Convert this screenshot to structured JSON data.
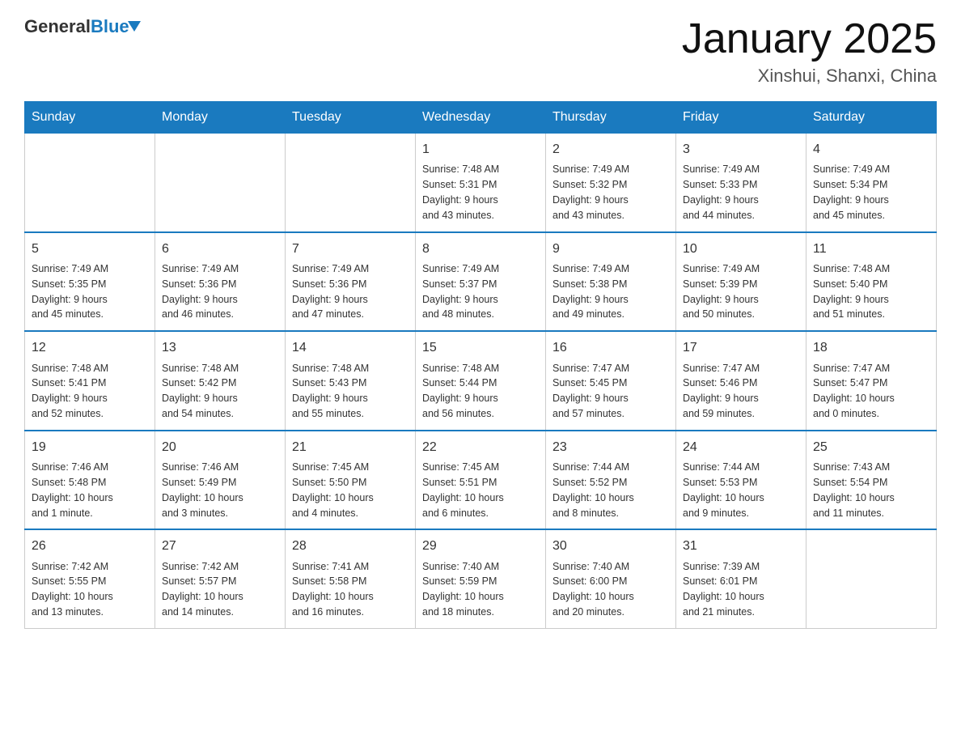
{
  "header": {
    "logo_general": "General",
    "logo_blue": "Blue",
    "title": "January 2025",
    "subtitle": "Xinshui, Shanxi, China"
  },
  "days_of_week": [
    "Sunday",
    "Monday",
    "Tuesday",
    "Wednesday",
    "Thursday",
    "Friday",
    "Saturday"
  ],
  "weeks": [
    [
      {
        "day": "",
        "info": ""
      },
      {
        "day": "",
        "info": ""
      },
      {
        "day": "",
        "info": ""
      },
      {
        "day": "1",
        "info": "Sunrise: 7:48 AM\nSunset: 5:31 PM\nDaylight: 9 hours\nand 43 minutes."
      },
      {
        "day": "2",
        "info": "Sunrise: 7:49 AM\nSunset: 5:32 PM\nDaylight: 9 hours\nand 43 minutes."
      },
      {
        "day": "3",
        "info": "Sunrise: 7:49 AM\nSunset: 5:33 PM\nDaylight: 9 hours\nand 44 minutes."
      },
      {
        "day": "4",
        "info": "Sunrise: 7:49 AM\nSunset: 5:34 PM\nDaylight: 9 hours\nand 45 minutes."
      }
    ],
    [
      {
        "day": "5",
        "info": "Sunrise: 7:49 AM\nSunset: 5:35 PM\nDaylight: 9 hours\nand 45 minutes."
      },
      {
        "day": "6",
        "info": "Sunrise: 7:49 AM\nSunset: 5:36 PM\nDaylight: 9 hours\nand 46 minutes."
      },
      {
        "day": "7",
        "info": "Sunrise: 7:49 AM\nSunset: 5:36 PM\nDaylight: 9 hours\nand 47 minutes."
      },
      {
        "day": "8",
        "info": "Sunrise: 7:49 AM\nSunset: 5:37 PM\nDaylight: 9 hours\nand 48 minutes."
      },
      {
        "day": "9",
        "info": "Sunrise: 7:49 AM\nSunset: 5:38 PM\nDaylight: 9 hours\nand 49 minutes."
      },
      {
        "day": "10",
        "info": "Sunrise: 7:49 AM\nSunset: 5:39 PM\nDaylight: 9 hours\nand 50 minutes."
      },
      {
        "day": "11",
        "info": "Sunrise: 7:48 AM\nSunset: 5:40 PM\nDaylight: 9 hours\nand 51 minutes."
      }
    ],
    [
      {
        "day": "12",
        "info": "Sunrise: 7:48 AM\nSunset: 5:41 PM\nDaylight: 9 hours\nand 52 minutes."
      },
      {
        "day": "13",
        "info": "Sunrise: 7:48 AM\nSunset: 5:42 PM\nDaylight: 9 hours\nand 54 minutes."
      },
      {
        "day": "14",
        "info": "Sunrise: 7:48 AM\nSunset: 5:43 PM\nDaylight: 9 hours\nand 55 minutes."
      },
      {
        "day": "15",
        "info": "Sunrise: 7:48 AM\nSunset: 5:44 PM\nDaylight: 9 hours\nand 56 minutes."
      },
      {
        "day": "16",
        "info": "Sunrise: 7:47 AM\nSunset: 5:45 PM\nDaylight: 9 hours\nand 57 minutes."
      },
      {
        "day": "17",
        "info": "Sunrise: 7:47 AM\nSunset: 5:46 PM\nDaylight: 9 hours\nand 59 minutes."
      },
      {
        "day": "18",
        "info": "Sunrise: 7:47 AM\nSunset: 5:47 PM\nDaylight: 10 hours\nand 0 minutes."
      }
    ],
    [
      {
        "day": "19",
        "info": "Sunrise: 7:46 AM\nSunset: 5:48 PM\nDaylight: 10 hours\nand 1 minute."
      },
      {
        "day": "20",
        "info": "Sunrise: 7:46 AM\nSunset: 5:49 PM\nDaylight: 10 hours\nand 3 minutes."
      },
      {
        "day": "21",
        "info": "Sunrise: 7:45 AM\nSunset: 5:50 PM\nDaylight: 10 hours\nand 4 minutes."
      },
      {
        "day": "22",
        "info": "Sunrise: 7:45 AM\nSunset: 5:51 PM\nDaylight: 10 hours\nand 6 minutes."
      },
      {
        "day": "23",
        "info": "Sunrise: 7:44 AM\nSunset: 5:52 PM\nDaylight: 10 hours\nand 8 minutes."
      },
      {
        "day": "24",
        "info": "Sunrise: 7:44 AM\nSunset: 5:53 PM\nDaylight: 10 hours\nand 9 minutes."
      },
      {
        "day": "25",
        "info": "Sunrise: 7:43 AM\nSunset: 5:54 PM\nDaylight: 10 hours\nand 11 minutes."
      }
    ],
    [
      {
        "day": "26",
        "info": "Sunrise: 7:42 AM\nSunset: 5:55 PM\nDaylight: 10 hours\nand 13 minutes."
      },
      {
        "day": "27",
        "info": "Sunrise: 7:42 AM\nSunset: 5:57 PM\nDaylight: 10 hours\nand 14 minutes."
      },
      {
        "day": "28",
        "info": "Sunrise: 7:41 AM\nSunset: 5:58 PM\nDaylight: 10 hours\nand 16 minutes."
      },
      {
        "day": "29",
        "info": "Sunrise: 7:40 AM\nSunset: 5:59 PM\nDaylight: 10 hours\nand 18 minutes."
      },
      {
        "day": "30",
        "info": "Sunrise: 7:40 AM\nSunset: 6:00 PM\nDaylight: 10 hours\nand 20 minutes."
      },
      {
        "day": "31",
        "info": "Sunrise: 7:39 AM\nSunset: 6:01 PM\nDaylight: 10 hours\nand 21 minutes."
      },
      {
        "day": "",
        "info": ""
      }
    ]
  ]
}
